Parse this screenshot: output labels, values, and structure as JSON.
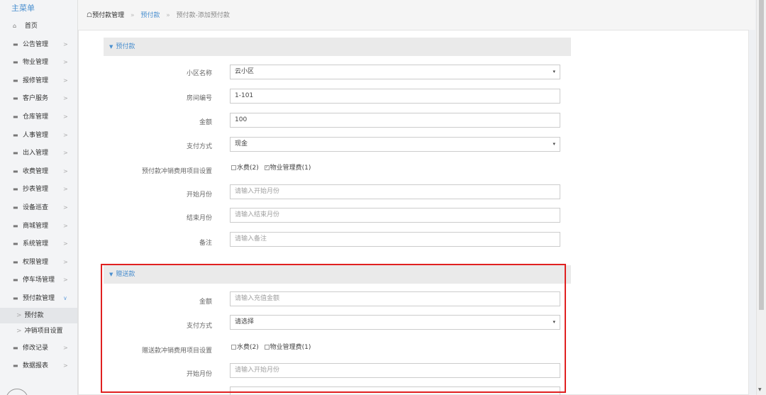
{
  "sidebar": {
    "title": "主菜单",
    "home": {
      "icon": "home-icon",
      "label": "首页"
    },
    "items": [
      {
        "label": "公告管理",
        "arrow": ">"
      },
      {
        "label": "物业管理",
        "arrow": ">"
      },
      {
        "label": "报修管理",
        "arrow": ">"
      },
      {
        "label": "客户服务",
        "arrow": ">"
      },
      {
        "label": "仓库管理",
        "arrow": ">"
      },
      {
        "label": "人事管理",
        "arrow": ">"
      },
      {
        "label": "出入管理",
        "arrow": ">"
      },
      {
        "label": "收费管理",
        "arrow": ">"
      },
      {
        "label": "抄表管理",
        "arrow": ">"
      },
      {
        "label": "设备巡查",
        "arrow": ">"
      },
      {
        "label": "商城管理",
        "arrow": ">"
      },
      {
        "label": "系统管理",
        "arrow": ">"
      },
      {
        "label": "权限管理",
        "arrow": ">"
      },
      {
        "label": "停车场管理",
        "arrow": ">"
      },
      {
        "label": "预付款管理",
        "arrow": "v"
      }
    ],
    "sub_items": [
      {
        "label": "预付款",
        "arrow": ">"
      },
      {
        "label": "冲销项目设置",
        "arrow": ">"
      }
    ],
    "items_after": [
      {
        "label": "修改记录",
        "arrow": ">"
      },
      {
        "label": "数据报表",
        "arrow": ">"
      }
    ]
  },
  "breadcrumb": {
    "home_icon": "home-icon",
    "home": "预付款管理",
    "sep": "»",
    "link": "预付款",
    "current": "预付款-添加预付款"
  },
  "section1": {
    "title": "预付款",
    "community": {
      "label": "小区名称",
      "value": "云小区"
    },
    "room": {
      "label": "房间编号",
      "value": "1-101"
    },
    "amount": {
      "label": "金额",
      "value": "100"
    },
    "payment": {
      "label": "支付方式",
      "value": "现金"
    },
    "offset": {
      "label": "预付款冲销费用项目设置",
      "opt1": "水费(2)",
      "opt1_checked": false,
      "opt2": "物业管理费(1)",
      "opt2_checked": true
    },
    "start_month": {
      "label": "开始月份",
      "placeholder": "请输入开始月份"
    },
    "end_month": {
      "label": "结束月份",
      "placeholder": "请输入结束月份"
    },
    "remark": {
      "label": "备注",
      "placeholder": "请输入备注"
    }
  },
  "section2": {
    "title": "赠送款",
    "amount": {
      "label": "金额",
      "placeholder": "请输入充值金额"
    },
    "payment": {
      "label": "支付方式",
      "value": "请选择"
    },
    "offset": {
      "label": "赠送款冲销费用项目设置",
      "opt1": "水费(2)",
      "opt1_checked": false,
      "opt2": "物业管理费(1)",
      "opt2_checked": false
    },
    "start_month": {
      "label": "开始月份",
      "placeholder": "请输入开始月份"
    }
  },
  "colors": {
    "accent": "#4a8fcf",
    "highlight": "#e02020",
    "section_bg": "#eaeaea"
  }
}
